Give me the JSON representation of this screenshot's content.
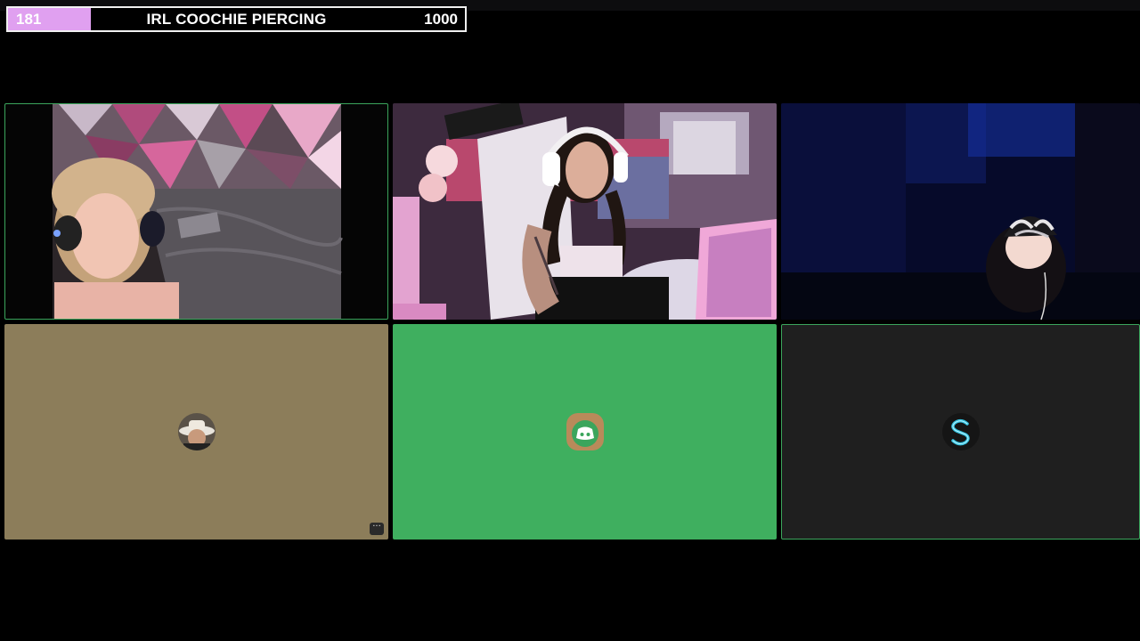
{
  "goal": {
    "current": "181",
    "title": "IRL COOCHIE PIERCING",
    "target": "1000",
    "progress": 0.181,
    "fill_color": "#e0a0f0"
  },
  "grid": {
    "tiles": [
      {
        "kind": "video",
        "speaking": true
      },
      {
        "kind": "video",
        "speaking": false
      },
      {
        "kind": "video",
        "speaking": false
      },
      {
        "kind": "avatar",
        "background": "#8c7d5a",
        "icon": "user-avatar-icon"
      },
      {
        "kind": "avatar",
        "background": "#3faf5f",
        "icon": "discord-logo-icon"
      },
      {
        "kind": "avatar",
        "background": "#1f1f1f",
        "icon": "letter-s-icon",
        "speaking": true
      }
    ],
    "more_button_label": "···"
  }
}
